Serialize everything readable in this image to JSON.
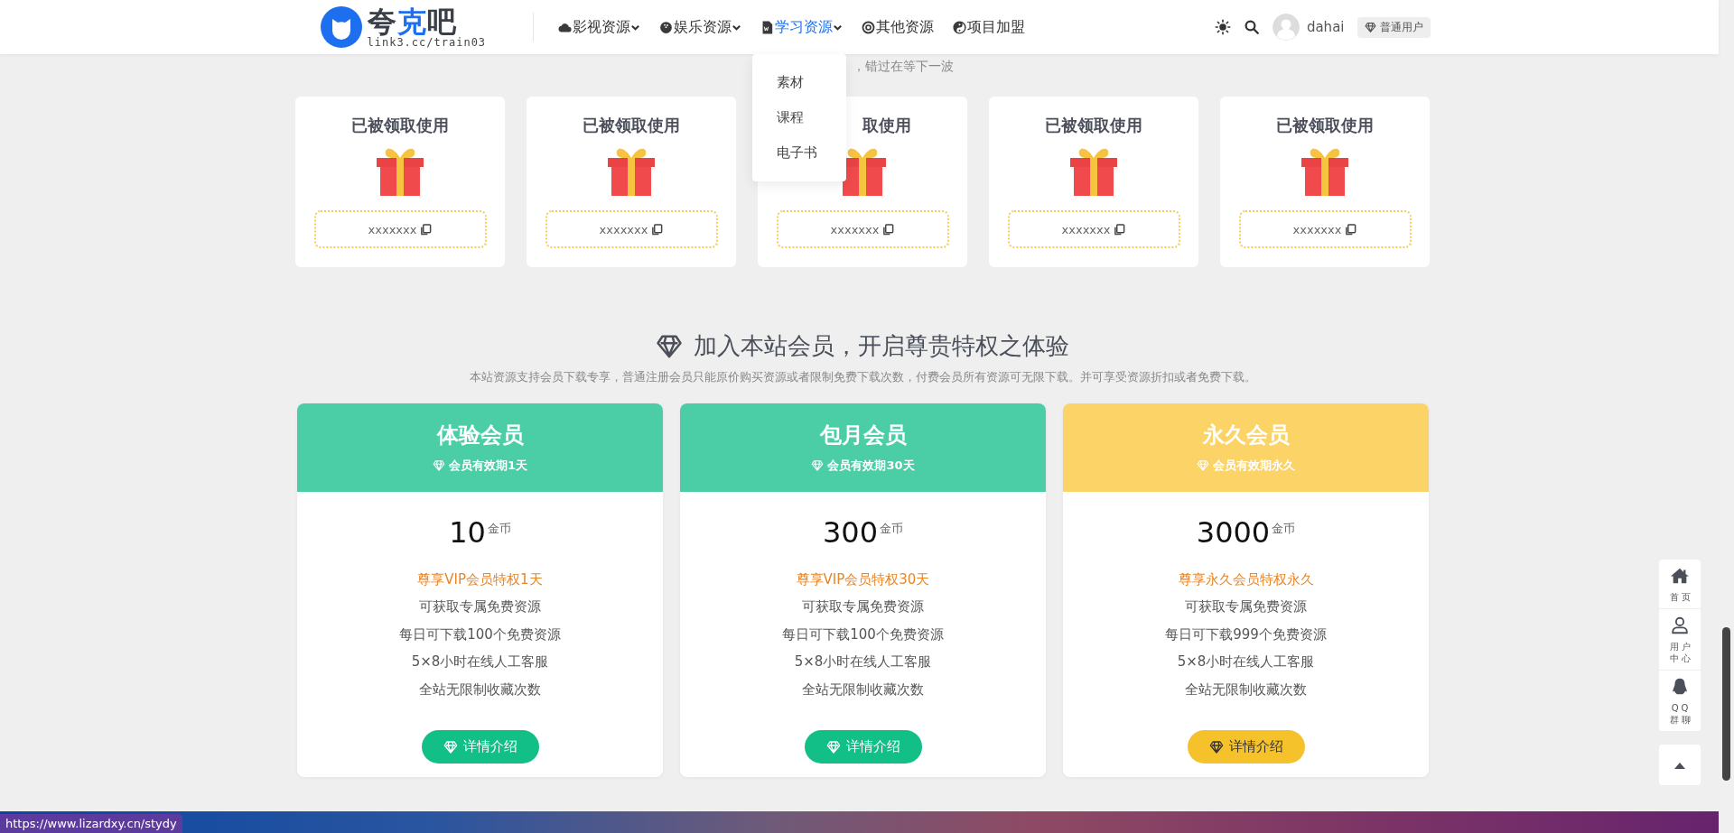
{
  "header": {
    "logo": {
      "title": [
        {
          "text": "夸",
          "highlight": false
        },
        {
          "text": "克",
          "highlight": true
        },
        {
          "text": "吧",
          "highlight": false
        }
      ],
      "subtitle": "link3.cc/train03"
    },
    "nav": [
      {
        "label": "影视资源",
        "has_menu": true,
        "expanded": false
      },
      {
        "label": "娱乐资源",
        "has_menu": true,
        "expanded": false
      },
      {
        "label": "学习资源",
        "has_menu": true,
        "expanded": true,
        "menu": [
          "素材",
          "课程",
          "电子书"
        ]
      },
      {
        "label": "其他资源",
        "has_menu": false,
        "expanded": false
      },
      {
        "label": "项目加盟",
        "has_menu": false,
        "expanded": false
      }
    ],
    "user": {
      "name": "dahai",
      "badge": "普通用户"
    }
  },
  "notice": "，错过在等下一波",
  "gift_cards": [
    {
      "title": "已被领取使用",
      "code": "xxxxxxx"
    },
    {
      "title": "已被领取使用",
      "code": "xxxxxxx"
    },
    {
      "title": "取使用",
      "code": "xxxxxxx"
    },
    {
      "title": "已被领取使用",
      "code": "xxxxxxx"
    },
    {
      "title": "已被领取使用",
      "code": "xxxxxxx"
    }
  ],
  "membership": {
    "title": "加入本站会员，开启尊贵特权之体验",
    "description": "本站资源支持会员下载专享，普通注册会员只能原价购买资源或者限制免费下载次数，付费会员所有资源可无限下载。并可享受资源折扣或者免费下载。",
    "plans": [
      {
        "kind": "green",
        "name": "体验会员",
        "validity": "会员有效期1天",
        "price": "10",
        "unit": "金币",
        "highlight": "尊享VIP会员特权1天",
        "features": [
          "可获取专属免费资源",
          "每日可下载100个免费资源",
          "5×8小时在线人工客服",
          "全站无限制收藏次数"
        ],
        "button": "详情介绍"
      },
      {
        "kind": "green",
        "name": "包月会员",
        "validity": "会员有效期30天",
        "price": "300",
        "unit": "金币",
        "highlight": "尊享VIP会员特权30天",
        "features": [
          "可获取专属免费资源",
          "每日可下载100个免费资源",
          "5×8小时在线人工客服",
          "全站无限制收藏次数"
        ],
        "button": "详情介绍"
      },
      {
        "kind": "gold",
        "name": "永久会员",
        "validity": "会员有效期永久",
        "price": "3000",
        "unit": "金币",
        "highlight": "尊享永久会员特权永久",
        "features": [
          "可获取专属免费资源",
          "每日可下载999个免费资源",
          "5×8小时在线人工客服",
          "全站无限制收藏次数"
        ],
        "button": "详情介绍"
      }
    ]
  },
  "side_tools": [
    "首页",
    "用户中心",
    "QQ群聊"
  ],
  "status_url": "https://www.lizardxy.cn/stydy"
}
